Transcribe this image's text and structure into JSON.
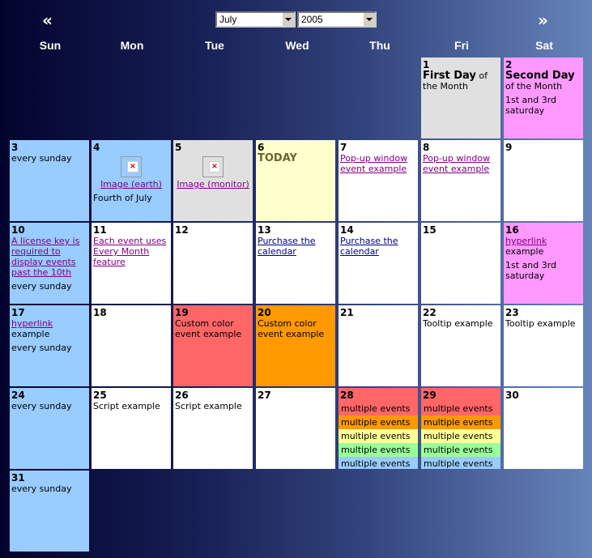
{
  "header": {
    "prev_label": "«",
    "next_label": "»",
    "month_select": "July",
    "year_select": "2005"
  },
  "weekdays": [
    "Sun",
    "Mon",
    "Tue",
    "Wed",
    "Thu",
    "Fri",
    "Sat"
  ],
  "colors": {
    "sunday": "#99ccff",
    "grey": "#e0e0e0",
    "pink": "#ff99ff",
    "today": "#ffffcc",
    "red": "#ff6666",
    "orange": "#ff9900",
    "yellow": "#ffff99",
    "green": "#99ff99",
    "blue": "#99ccff"
  },
  "days": {
    "d1": {
      "num": "1",
      "title_bold": "First Day",
      "title_rest": " of the Month"
    },
    "d2": {
      "num": "2",
      "title_bold": "Second Day",
      "title_rest": "of the Month",
      "note": "1st and 3rd saturday"
    },
    "d3": {
      "num": "3",
      "note": "every sunday"
    },
    "d4": {
      "num": "4",
      "link": "Image (earth)",
      "note": "Fourth of July"
    },
    "d5": {
      "num": "5",
      "link": "Image (monitor)"
    },
    "d6": {
      "num": "6",
      "note": "TODAY"
    },
    "d7": {
      "num": "7",
      "link": "Pop-up window event example"
    },
    "d8": {
      "num": "8",
      "link": "Pop-up window event example"
    },
    "d9": {
      "num": "9"
    },
    "d10": {
      "num": "10",
      "link": "A license key is required to display events past the 10th",
      "note": "every sunday"
    },
    "d11": {
      "num": "11",
      "link": "Each event uses Every Month feature"
    },
    "d12": {
      "num": "12"
    },
    "d13": {
      "num": "13",
      "link": "Purchase the calendar"
    },
    "d14": {
      "num": "14",
      "link": "Purchase the calendar"
    },
    "d15": {
      "num": "15"
    },
    "d16": {
      "num": "16",
      "link": "hyperlink",
      "link_rest": "example",
      "note": "1st and 3rd saturday"
    },
    "d17": {
      "num": "17",
      "link": "hyperlink",
      "link_rest": "example",
      "note": "every sunday"
    },
    "d18": {
      "num": "18"
    },
    "d19": {
      "num": "19",
      "note": "Custom color event example"
    },
    "d20": {
      "num": "20",
      "note": "Custom color event example"
    },
    "d21": {
      "num": "21"
    },
    "d22": {
      "num": "22",
      "note": "Tooltip example"
    },
    "d23": {
      "num": "23",
      "note": "Tooltip example"
    },
    "d24": {
      "num": "24",
      "note": "every sunday"
    },
    "d25": {
      "num": "25",
      "note": "Script example"
    },
    "d26": {
      "num": "26",
      "note": "Script example"
    },
    "d27": {
      "num": "27"
    },
    "d28": {
      "num": "28",
      "events": [
        "multiple events",
        "multiple events",
        "multiple events",
        "multiple events",
        "multiple events"
      ]
    },
    "d29": {
      "num": "29",
      "events": [
        "multiple events",
        "multiple events",
        "multiple events",
        "multiple events",
        "multiple events"
      ]
    },
    "d30": {
      "num": "30"
    },
    "d31": {
      "num": "31",
      "note": "every sunday"
    }
  }
}
